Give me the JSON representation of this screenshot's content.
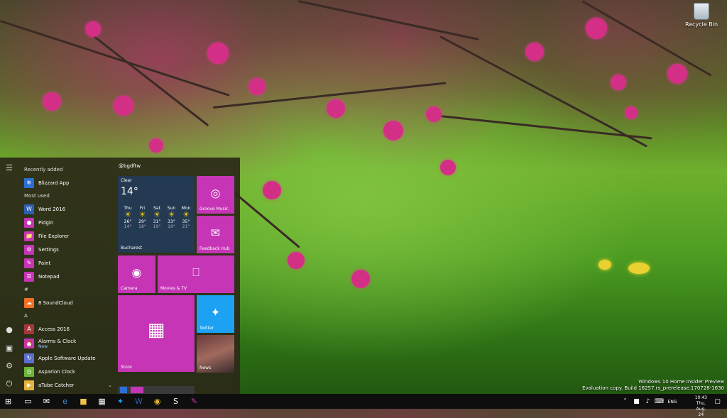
{
  "desktop": {
    "recycle_bin_label": "Recycle Bin",
    "watermark_line1": "Windows 10 Home Insider Preview",
    "watermark_line2": "Evaluation copy. Build 16257.rs_prerelease.170728-1630"
  },
  "start_menu": {
    "recently_added_label": "Recently added",
    "most_used_label": "Most used",
    "hash_label": "#",
    "a_label": "A",
    "apps": {
      "blizzard": "Blizzard App",
      "word": "Word 2016",
      "pidgin": "Pidgin",
      "explorer": "File Explorer",
      "settings": "Settings",
      "paint": "Paint",
      "notepad": "Notepad",
      "soundcloud": "8 SoundCloud",
      "access": "Access 2016",
      "alarms": "Alarms & Clock",
      "alarms_badge": "New",
      "apple": "Apple Software Update",
      "asparion": "Asparion Clock",
      "atube": "aTube Catcher"
    },
    "tiles_header": "@bgdftw",
    "weather": {
      "condition": "Clear",
      "temp": "14°",
      "city": "Bucharest",
      "days": [
        {
          "d": "Thu",
          "hi": "26°",
          "lo": "14°"
        },
        {
          "d": "Fri",
          "hi": "29°",
          "lo": "18°"
        },
        {
          "d": "Sat",
          "hi": "31°",
          "lo": "19°"
        },
        {
          "d": "Sun",
          "hi": "33°",
          "lo": "19°"
        },
        {
          "d": "Mon",
          "hi": "35°",
          "lo": "21°"
        }
      ]
    },
    "tiles": {
      "groove": "Groove Music",
      "feedback": "Feedback Hub",
      "camera": "Camera",
      "movies": "Movies & TV",
      "store": "Store",
      "twitter": "Twitter",
      "news": "News"
    }
  },
  "taskbar": {
    "lang": "ENG",
    "time": "10:43",
    "date": "Thu, Aug. 24"
  },
  "colors": {
    "accent": "#c535b5",
    "twitter": "#1da1f2"
  }
}
